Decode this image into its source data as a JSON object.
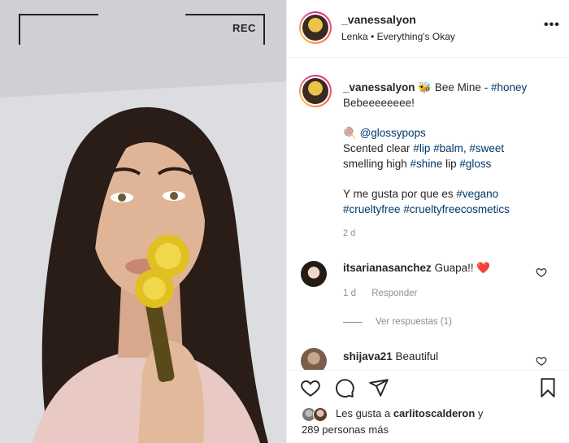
{
  "media": {
    "rec_label": "REC"
  },
  "post_header": {
    "username": "_vanessalyon",
    "song": "Lenka • Everything's Okay",
    "more_label": "•••"
  },
  "caption": {
    "username": "_vanessalyon",
    "emoji": "🐝",
    "lines": [
      {
        "segments": [
          {
            "text": "Bee Mine - ",
            "tag": false
          },
          {
            "text": "#honey",
            "tag": true
          }
        ]
      },
      {
        "segments": [
          {
            "text": "Bebeeeeeeee!",
            "tag": false
          }
        ]
      },
      {
        "segments": []
      },
      {
        "segments": [
          {
            "text": "🍭 ",
            "tag": false
          },
          {
            "text": "@glossypops",
            "tag": true
          }
        ]
      },
      {
        "segments": [
          {
            "text": "Scented clear ",
            "tag": false
          },
          {
            "text": "#lip",
            "tag": true
          },
          {
            "text": " ",
            "tag": false
          },
          {
            "text": "#balm",
            "tag": true
          },
          {
            "text": ", ",
            "tag": false
          },
          {
            "text": "#sweet",
            "tag": true
          }
        ]
      },
      {
        "segments": [
          {
            "text": "smelling high ",
            "tag": false
          },
          {
            "text": "#shine",
            "tag": true
          },
          {
            "text": " lip ",
            "tag": false
          },
          {
            "text": "#gloss",
            "tag": true
          }
        ]
      },
      {
        "segments": []
      },
      {
        "segments": [
          {
            "text": "Y me gusta por que es ",
            "tag": false
          },
          {
            "text": "#vegano",
            "tag": true
          }
        ]
      },
      {
        "segments": [
          {
            "text": "#crueltyfree",
            "tag": true
          },
          {
            "text": " ",
            "tag": false
          },
          {
            "text": "#crueltyfreecosmetics",
            "tag": true
          }
        ]
      }
    ],
    "time": "2 d"
  },
  "comments": [
    {
      "username": "itsarianasanchez",
      "text": " Guapa!! ",
      "emoji": "❤️",
      "time": "1 d",
      "reply_label": "Responder",
      "view_replies": "Ver respuestas (1)"
    },
    {
      "username": "shijava21",
      "text": " Beautiful"
    }
  ],
  "likes": {
    "prefix": "Les gusta a ",
    "user": "carlitoscalderon",
    "middle": " y",
    "count_text": "289 personas más"
  },
  "colors": {
    "tag": "#00376b",
    "heart_red": "#ed4956",
    "muted": "#8e8e8e"
  }
}
